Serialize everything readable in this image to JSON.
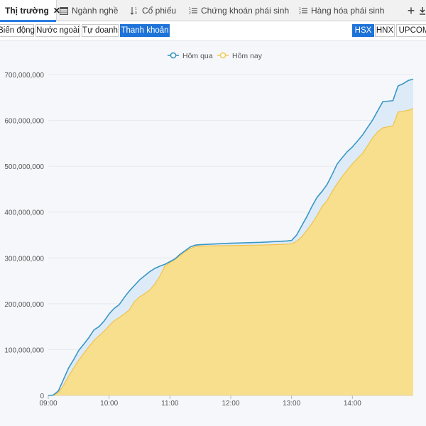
{
  "tabs": [
    {
      "label": "Thị trường",
      "icon": "close-icon",
      "close": "✕"
    },
    {
      "label": "Ngành nghề",
      "icon": "table-icon"
    },
    {
      "label": "Cổ phiếu",
      "icon": "sort-numeric-icon"
    },
    {
      "label": "Chứng khoán phái sinh",
      "icon": "list-numbered-icon"
    },
    {
      "label": "Hàng hóa phái sinh",
      "icon": "list-numbered-icon"
    }
  ],
  "toolbar": {
    "add_label": "+",
    "download_icon": "download-icon"
  },
  "views": {
    "items": [
      "Biến động",
      "Nước ngoài",
      "Tự doanh",
      "Thanh khoản"
    ],
    "selected": "Thanh khoản"
  },
  "exchanges": {
    "items": [
      "HSX",
      "HNX",
      "UPCOM"
    ],
    "selected": "HSX"
  },
  "colors": {
    "yesterday": "#3a97c4",
    "yesterday_fill": "#dcebf7",
    "today": "#f3cb5c",
    "today_fill": "#f7df8e",
    "accent": "#1e73d8"
  },
  "chart_data": {
    "type": "area",
    "title": "",
    "xlabel": "",
    "ylabel": "",
    "legend_position": "top-center",
    "grid": true,
    "ylim": [
      0,
      700000000
    ],
    "yticks": [
      0,
      100000000,
      200000000,
      300000000,
      400000000,
      500000000,
      600000000,
      700000000
    ],
    "ytick_labels": [
      "0",
      "100,000,000",
      "200,000,000",
      "300,000,000",
      "400,000,000",
      "500,000,000",
      "600,000,000",
      "700,000,000"
    ],
    "xlim": [
      "09:00",
      "15:00"
    ],
    "xtick_labels": [
      "09:00",
      "10:00",
      "11:00",
      "12:00",
      "13:00",
      "14:00"
    ],
    "series": [
      {
        "name": "Hôm qua",
        "points": [
          [
            "09:00",
            0
          ],
          [
            "09:05",
            1000000
          ],
          [
            "09:10",
            10000000
          ],
          [
            "09:15",
            35000000
          ],
          [
            "09:20",
            60000000
          ],
          [
            "09:25",
            78000000
          ],
          [
            "09:30",
            98000000
          ],
          [
            "09:35",
            112000000
          ],
          [
            "09:40",
            126000000
          ],
          [
            "09:45",
            143000000
          ],
          [
            "09:50",
            150000000
          ],
          [
            "09:55",
            162000000
          ],
          [
            "10:00",
            178000000
          ],
          [
            "10:05",
            190000000
          ],
          [
            "10:10",
            198000000
          ],
          [
            "10:15",
            214000000
          ],
          [
            "10:20",
            228000000
          ],
          [
            "10:25",
            240000000
          ],
          [
            "10:30",
            252000000
          ],
          [
            "10:35",
            261000000
          ],
          [
            "10:40",
            270000000
          ],
          [
            "10:45",
            277000000
          ],
          [
            "10:50",
            282000000
          ],
          [
            "10:55",
            286000000
          ],
          [
            "11:00",
            292000000
          ],
          [
            "11:05",
            298000000
          ],
          [
            "11:10",
            308000000
          ],
          [
            "11:15",
            316000000
          ],
          [
            "11:20",
            324000000
          ],
          [
            "11:25",
            328000000
          ],
          [
            "11:30",
            329000000
          ],
          [
            "12:00",
            332000000
          ],
          [
            "12:30",
            334000000
          ],
          [
            "12:55",
            337000000
          ],
          [
            "13:00",
            338000000
          ],
          [
            "13:05",
            350000000
          ],
          [
            "13:10",
            370000000
          ],
          [
            "13:15",
            390000000
          ],
          [
            "13:20",
            412000000
          ],
          [
            "13:25",
            432000000
          ],
          [
            "13:30",
            445000000
          ],
          [
            "13:35",
            460000000
          ],
          [
            "13:40",
            482000000
          ],
          [
            "13:45",
            505000000
          ],
          [
            "13:50",
            519000000
          ],
          [
            "13:55",
            532000000
          ],
          [
            "14:00",
            542000000
          ],
          [
            "14:05",
            555000000
          ],
          [
            "14:10",
            568000000
          ],
          [
            "14:15",
            585000000
          ],
          [
            "14:20",
            601000000
          ],
          [
            "14:25",
            621000000
          ],
          [
            "14:30",
            641000000
          ],
          [
            "14:35",
            642000000
          ],
          [
            "14:40",
            643000000
          ],
          [
            "14:45",
            675000000
          ],
          [
            "14:50",
            680000000
          ],
          [
            "14:55",
            687000000
          ],
          [
            "15:00",
            690000000
          ]
        ]
      },
      {
        "name": "Hôm nay",
        "points": [
          [
            "09:00",
            0
          ],
          [
            "09:05",
            500000
          ],
          [
            "09:10",
            6000000
          ],
          [
            "09:15",
            22000000
          ],
          [
            "09:20",
            42000000
          ],
          [
            "09:25",
            60000000
          ],
          [
            "09:30",
            77000000
          ],
          [
            "09:35",
            92000000
          ],
          [
            "09:40",
            106000000
          ],
          [
            "09:45",
            120000000
          ],
          [
            "09:50",
            130000000
          ],
          [
            "09:55",
            140000000
          ],
          [
            "10:00",
            152000000
          ],
          [
            "10:05",
            163000000
          ],
          [
            "10:10",
            170000000
          ],
          [
            "10:15",
            178000000
          ],
          [
            "10:20",
            187000000
          ],
          [
            "10:25",
            205000000
          ],
          [
            "10:30",
            215000000
          ],
          [
            "10:35",
            222000000
          ],
          [
            "10:40",
            230000000
          ],
          [
            "10:45",
            243000000
          ],
          [
            "10:50",
            260000000
          ],
          [
            "10:55",
            282000000
          ],
          [
            "11:00",
            290000000
          ],
          [
            "11:05",
            297000000
          ],
          [
            "11:10",
            305000000
          ],
          [
            "11:15",
            314000000
          ],
          [
            "11:20",
            320000000
          ],
          [
            "11:25",
            325000000
          ],
          [
            "11:30",
            326000000
          ],
          [
            "12:00",
            327000000
          ],
          [
            "12:30",
            328000000
          ],
          [
            "12:55",
            330000000
          ],
          [
            "13:00",
            331000000
          ],
          [
            "13:05",
            336000000
          ],
          [
            "13:10",
            346000000
          ],
          [
            "13:15",
            360000000
          ],
          [
            "13:20",
            375000000
          ],
          [
            "13:25",
            392000000
          ],
          [
            "13:30",
            412000000
          ],
          [
            "13:35",
            425000000
          ],
          [
            "13:40",
            445000000
          ],
          [
            "13:45",
            462000000
          ],
          [
            "13:50",
            478000000
          ],
          [
            "13:55",
            492000000
          ],
          [
            "14:00",
            505000000
          ],
          [
            "14:05",
            517000000
          ],
          [
            "14:10",
            528000000
          ],
          [
            "14:15",
            545000000
          ],
          [
            "14:20",
            562000000
          ],
          [
            "14:25",
            575000000
          ],
          [
            "14:30",
            584000000
          ],
          [
            "14:35",
            586000000
          ],
          [
            "14:40",
            588000000
          ],
          [
            "14:45",
            618000000
          ],
          [
            "14:50",
            620000000
          ],
          [
            "14:55",
            622000000
          ],
          [
            "15:00",
            626000000
          ]
        ]
      }
    ]
  }
}
